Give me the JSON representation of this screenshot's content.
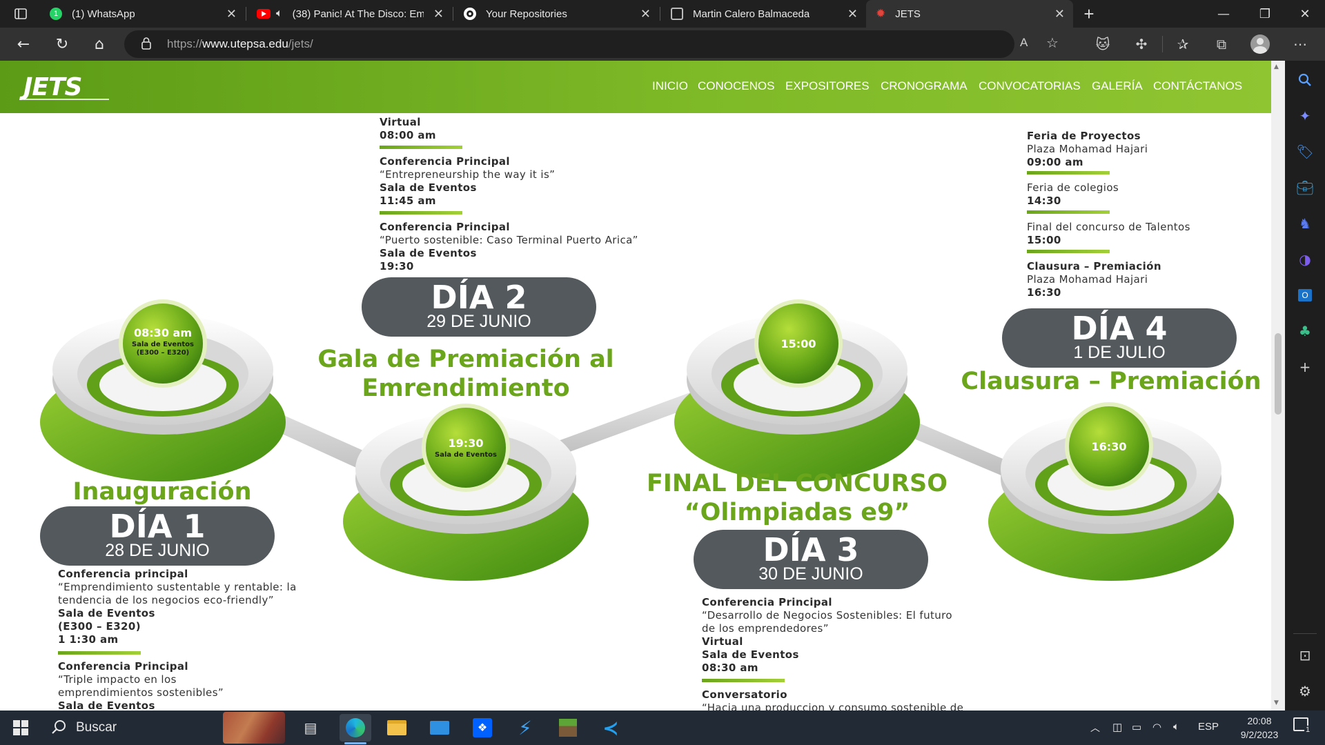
{
  "browser": {
    "tabs": [
      {
        "title": "(1) WhatsApp",
        "icon": "whatsapp-icon"
      },
      {
        "title": "(38) Panic! At The Disco: Em",
        "icon": "youtube-icon"
      },
      {
        "title": "Your Repositories",
        "icon": "github-icon"
      },
      {
        "title": "Martin Calero Balmaceda",
        "icon": "profile-page-icon"
      },
      {
        "title": "JETS",
        "icon": "jets-icon"
      }
    ],
    "url_prefix": "https://",
    "url_domain": "www.utepsa.edu",
    "url_path": "/jets/"
  },
  "site": {
    "logo": "JETS",
    "menu": [
      "INICIO",
      "CONOCENOS",
      "EXPOSITORES",
      "CRONOGRAMA",
      "CONVOCATORIAS",
      "GALERÍA",
      "CONTÁCTANOS"
    ]
  },
  "day1": {
    "day": "DÍA 1",
    "date": "28 DE JUNIO",
    "event": "Inauguración",
    "ball_time": "08:30 am",
    "ball_place": "Sala de Eventos",
    "ball_rooms": "(E300 – E320)",
    "items": [
      {
        "title": "Conferencia principal",
        "lines": [
          "“Emprendimiento sustentable y rentable: la",
          "tendencia de los negocios eco-friendly”"
        ],
        "bold": [
          "Sala de Eventos",
          "(E300 – E320)",
          "1 1:30 am"
        ]
      },
      {
        "title": "Conferencia Principal",
        "lines": [
          "“Triple impacto en los",
          "emprendimientos sostenibles”"
        ],
        "bold": [
          "Sala de Eventos"
        ]
      }
    ]
  },
  "day2": {
    "day": "DÍA 2",
    "date": "29 DE JUNIO",
    "event_line1": "Gala de Premiación al",
    "event_line2": "Emrendimiento",
    "ball_time": "19:30",
    "ball_place": "Sala de Eventos",
    "items": [
      {
        "bold": [
          "Virtual",
          "08:00 am"
        ]
      },
      {
        "title": "Conferencia Principal",
        "lines": [
          "“Entrepreneurship the way it is”"
        ],
        "bold": [
          "Sala de Eventos",
          "11:45 am"
        ]
      },
      {
        "title": "Conferencia Principal",
        "lines": [
          "“Puerto sostenible: Caso Terminal Puerto Arica”"
        ],
        "bold": [
          "Sala de Eventos",
          "19:30"
        ]
      }
    ]
  },
  "day3": {
    "day": "DÍA 3",
    "date": "30 DE JUNIO",
    "event_line1": "FINAL DEL CONCURSO",
    "event_line2": "“Olimpiadas e9”",
    "ball_time": "15:00",
    "items": [
      {
        "title": "Conferencia Principal",
        "lines": [
          "“Desarrollo de Negocios Sostenibles: El futuro",
          "de los emprendedores”"
        ],
        "bold": [
          "Virtual",
          "Sala de Eventos",
          "08:30 am"
        ]
      },
      {
        "title": "Conversatorio",
        "lines": [
          "“Hacia una produccion y consumo sostenible de"
        ]
      }
    ]
  },
  "day4": {
    "day": "DÍA 4",
    "date": "1 DE JULIO",
    "event": "Clausura – Premiación",
    "ball_time": "16:30",
    "items": [
      {
        "title": "Feria de Proyectos",
        "lines": [
          "Plaza Mohamad Hajari"
        ],
        "bold": [
          "09:00 am"
        ]
      },
      {
        "lines": [
          "Feria de colegios"
        ],
        "bold": [
          "14:30"
        ]
      },
      {
        "lines": [
          "Final del concurso de Talentos"
        ],
        "bold": [
          "15:00"
        ]
      },
      {
        "title": "Clausura – Premiación",
        "lines": [
          "Plaza Mohamad Hajari"
        ],
        "bold": [
          "16:30"
        ]
      }
    ]
  },
  "taskbar": {
    "search": "Buscar",
    "lang": "ESP",
    "time": "20:08",
    "date": "9/2/2023",
    "notif_count": "1"
  },
  "colors": {
    "green": "#7cb82a",
    "dark_pill": "#53595c",
    "title_green": "#6aa51b"
  }
}
